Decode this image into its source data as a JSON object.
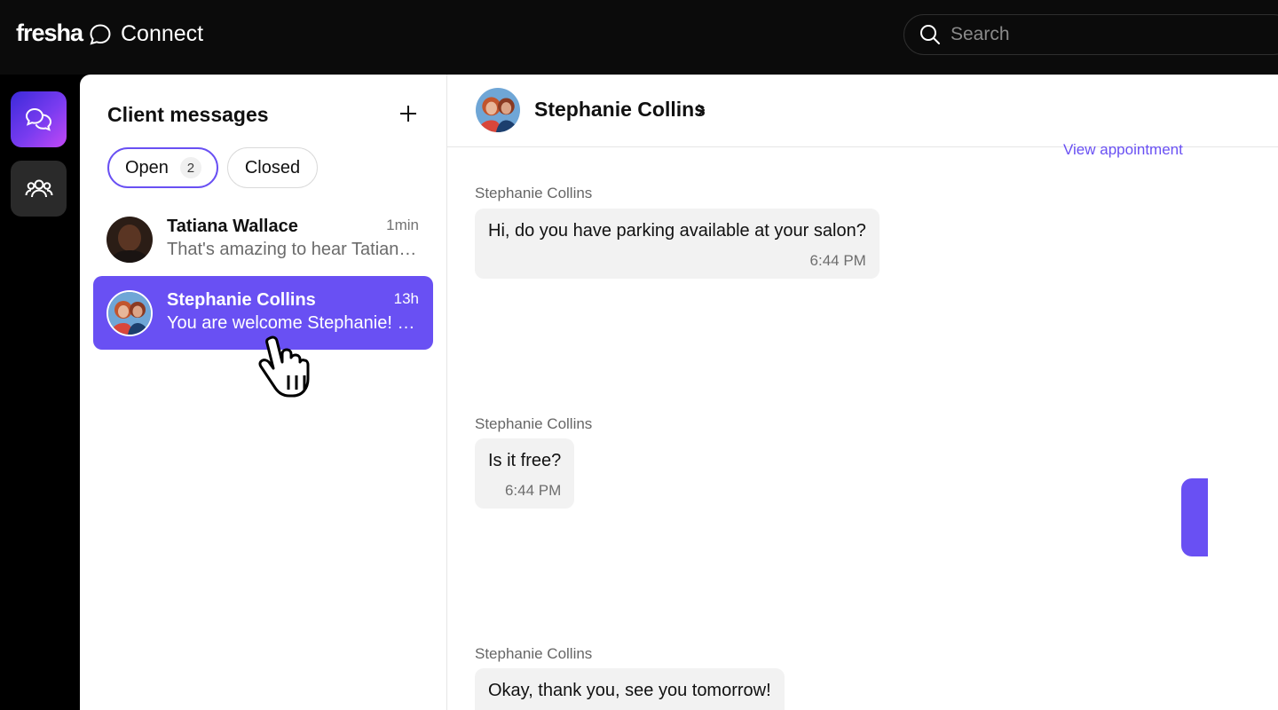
{
  "app": {
    "logo": "fresha",
    "section": "Connect"
  },
  "search": {
    "placeholder": "Search"
  },
  "rail": {
    "items": [
      {
        "icon": "messages-icon",
        "active": true
      },
      {
        "icon": "clients-icon",
        "active": false
      }
    ]
  },
  "list": {
    "title": "Client messages",
    "filters": {
      "open_label": "Open",
      "open_count": "2",
      "closed_label": "Closed"
    },
    "conversations": [
      {
        "name": "Tatiana Wallace",
        "time": "1min",
        "preview": "That's amazing to hear Tatiana! We look forward to seeing you",
        "selected": false
      },
      {
        "name": "Stephanie Collins",
        "time": "13h",
        "preview": "You are welcome Stephanie! See you tomorrow",
        "selected": true
      }
    ]
  },
  "chat": {
    "contact_name": "Stephanie Collins",
    "view_appointment": "View appointment",
    "messages": [
      {
        "sender": "Stephanie Collins",
        "text": "Hi, do you have parking available at your salon?",
        "time": "6:44 PM"
      },
      {
        "sender": "Stephanie Collins",
        "text": "Is it free?",
        "time": "6:44 PM"
      },
      {
        "sender": "Stephanie Collins",
        "text": "Okay, thank you, see you tomorrow!",
        "time": ""
      }
    ]
  },
  "colors": {
    "accent": "#6950f3",
    "background": "#0b0b0b",
    "bubble": "#f2f2f2"
  }
}
